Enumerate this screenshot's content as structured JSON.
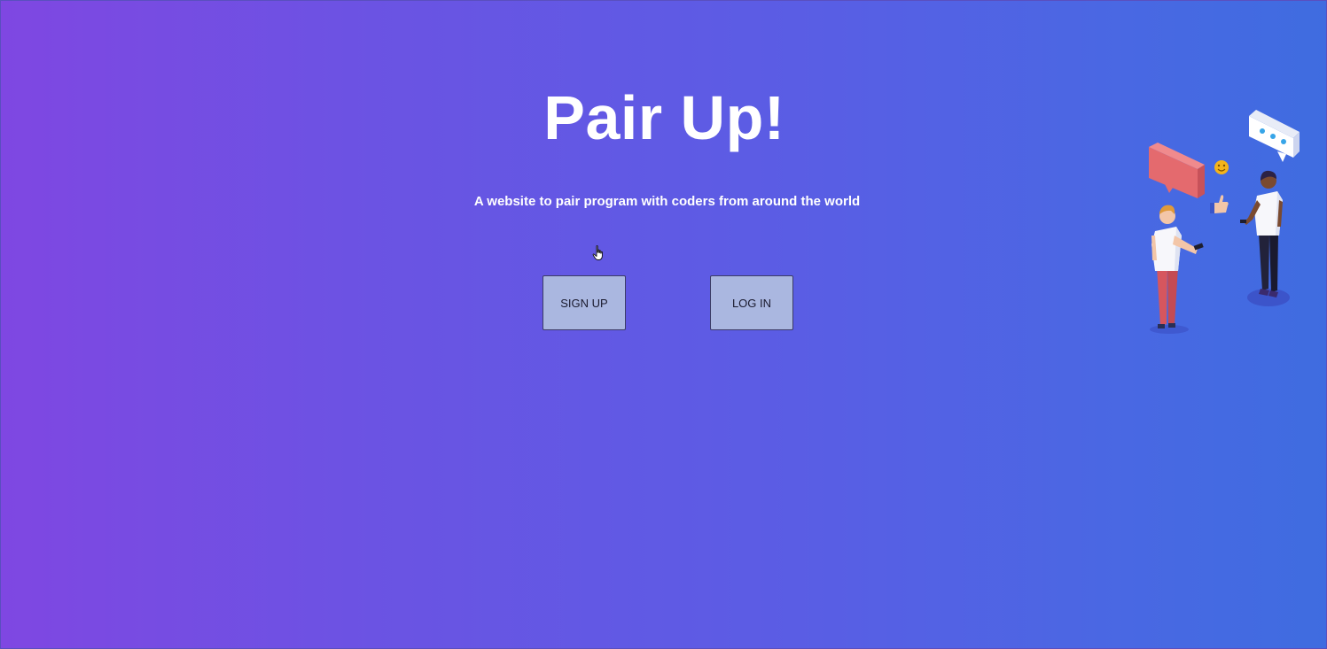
{
  "hero": {
    "title": "Pair Up!",
    "subtitle": "A website to pair program with coders from around the world"
  },
  "actions": {
    "signup_label": "SIGN UP",
    "login_label": "LOG IN"
  },
  "colors": {
    "gradient_start": "#7f47e2",
    "gradient_end": "#3f6ce0",
    "button_bg": "#aab7e0",
    "text": "#ffffff"
  },
  "icons": {
    "cursor": "hand-pointer-icon",
    "illustration": "people-chatting-illustration"
  }
}
